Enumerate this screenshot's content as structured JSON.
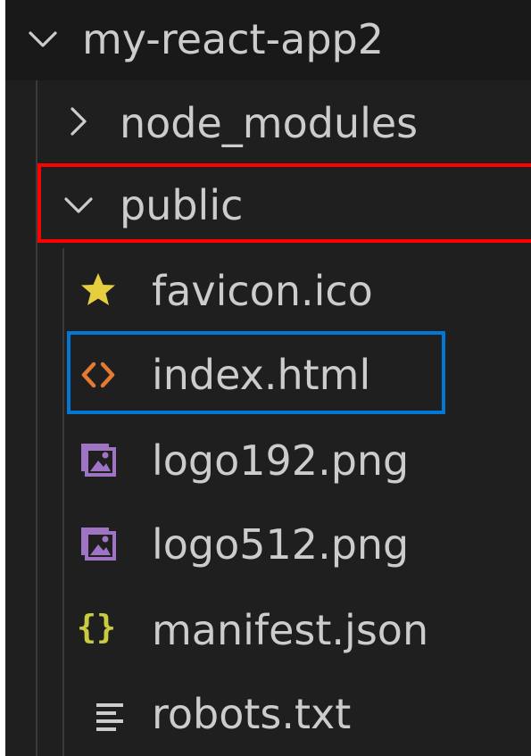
{
  "explorer": {
    "root": {
      "label": "my-react-app2",
      "icon": "chevron-down-icon"
    },
    "items": [
      {
        "label": "node_modules",
        "icon": "chevron-right-icon",
        "kind": "folder",
        "expanded": false
      },
      {
        "label": "public",
        "icon": "chevron-down-icon",
        "kind": "folder",
        "expanded": true,
        "highlight": "red"
      },
      {
        "label": "favicon.ico",
        "icon": "star-icon",
        "kind": "file"
      },
      {
        "label": "index.html",
        "icon": "html-brackets-icon",
        "kind": "file",
        "highlight": "blue"
      },
      {
        "label": "logo192.png",
        "icon": "image-icon",
        "kind": "file"
      },
      {
        "label": "logo512.png",
        "icon": "image-icon",
        "kind": "file"
      },
      {
        "label": "manifest.json",
        "icon": "json-braces-icon",
        "kind": "file"
      },
      {
        "label": "robots.txt",
        "icon": "text-lines-icon",
        "kind": "file"
      }
    ]
  },
  "colors": {
    "panel_background": "#1f1f1f",
    "root_background": "#191919",
    "text": "#cccccc",
    "red_highlight": "#ff0000",
    "blue_highlight": "#0078d4",
    "star_icon": "#e5cf3f",
    "html_icon": "#e37933",
    "image_icon": "#a074c4",
    "json_icon": "#cbcb41"
  }
}
